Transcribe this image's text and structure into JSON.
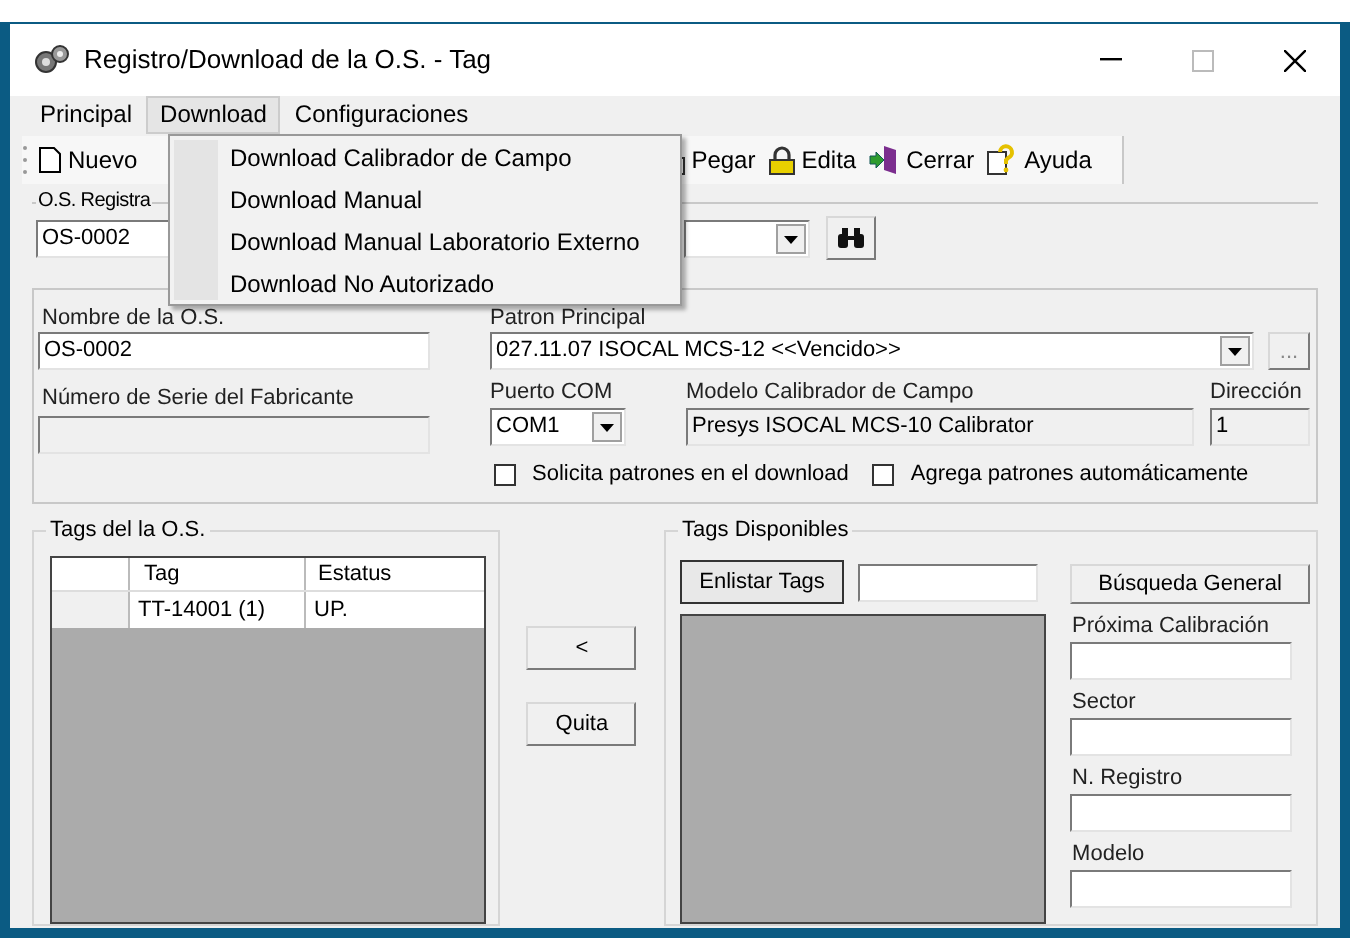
{
  "window": {
    "title": "Registro/Download de la O.S. - Tag"
  },
  "menu": [
    {
      "label": "Principal",
      "selected": false
    },
    {
      "label": "Download",
      "selected": true
    },
    {
      "label": "Configuraciones",
      "selected": false
    }
  ],
  "dropdown": [
    "Download Calibrador de Campo",
    "Download Manual",
    "Download Manual Laboratorio Externo",
    "Download No Autorizado"
  ],
  "toolbar": [
    {
      "kind": "new",
      "label": "Nuevo"
    },
    {
      "kind": "paste",
      "label": "Pegar"
    },
    {
      "kind": "lock",
      "label": "Edita"
    },
    {
      "kind": "exit",
      "label": "Cerrar"
    },
    {
      "kind": "help",
      "label": "Ayuda"
    }
  ],
  "os_registrada": {
    "label": "O.S. Registra",
    "value": "OS-0002"
  },
  "form": {
    "nombre_label": "Nombre de la O.S.",
    "nombre": "OS-0002",
    "serie_label": "Número de Serie del Fabricante",
    "patron_label": "Patron Principal",
    "patron": "027.11.07 ISOCAL MCS-12 <<Vencido>>",
    "patron_button": "...",
    "puerto_label": "Puerto COM",
    "puerto": "COM1",
    "modelo_label": "Modelo Calibrador de Campo",
    "modelo": "Presys ISOCAL MCS-10 Calibrator",
    "direccion_label": "Dirección",
    "direccion": "1"
  },
  "options": [
    {
      "label": "Solicita patrones en el download",
      "checked": false
    },
    {
      "label": "Agrega patrones automáticamente",
      "checked": false
    }
  ],
  "tags_os": {
    "title": "Tags del la O.S.",
    "columns": [
      "Tag",
      "Estatus"
    ],
    "rows": [
      [
        "TT-14001 (1)",
        "UP."
      ]
    ]
  },
  "middle_buttons": [
    "<",
    "Quita"
  ],
  "tags_disponibles": {
    "title": "Tags Disponibles",
    "list_button": "Enlistar Tags",
    "search_button": "Búsqueda General",
    "fields": [
      "Próxima Calibración",
      "Sector",
      "N. Registro",
      "Modelo"
    ]
  }
}
